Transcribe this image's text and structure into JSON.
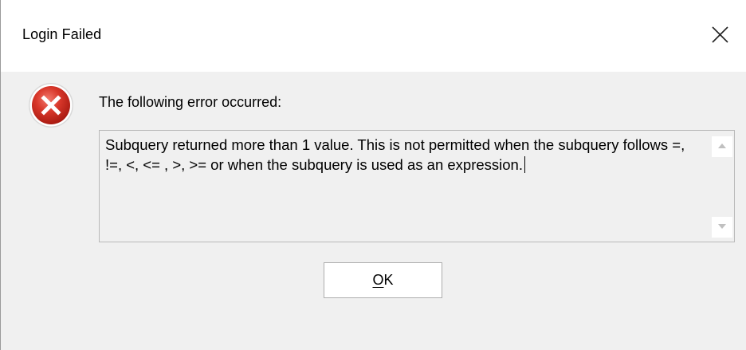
{
  "window": {
    "title": "Login Failed",
    "close_icon": "close-icon"
  },
  "dialog": {
    "icon": "error-icon",
    "message": "The following error occurred:",
    "detail": "Subquery returned more than 1 value. This is not permitted when the subquery follows =, !=, <, <= , >, >= or when the subquery is used as an expression.",
    "scroll_up_icon": "scroll-up-arrow-icon",
    "scroll_down_icon": "scroll-down-arrow-icon"
  },
  "buttons": {
    "ok_mnemonic": "O",
    "ok_rest": "K"
  },
  "colors": {
    "error_red": "#c42b1c",
    "window_bg": "#f0f0f0",
    "title_bg": "#ffffff"
  }
}
